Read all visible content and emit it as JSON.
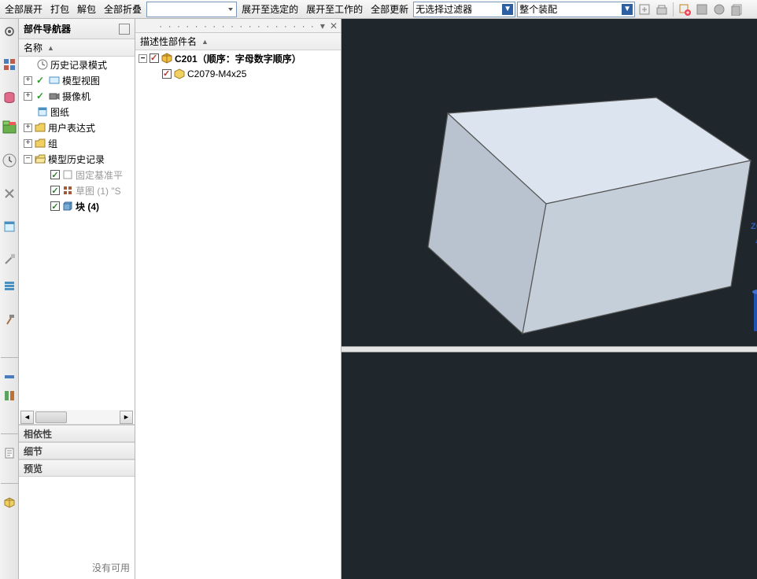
{
  "toolbar": {
    "expand_all": "全部展开",
    "pack": "打包",
    "unpack": "解包",
    "collapse_all": "全部折叠",
    "expand_to_selected": "展开至选定的",
    "expand_to_working": "展开至工作的",
    "update_all": "全部更新",
    "filter_select": "无选择过滤器",
    "scope_select": "整个装配"
  },
  "part_navigator": {
    "title": "部件导航器",
    "col_name": "名称",
    "items": {
      "history_mode": "历史记录模式",
      "model_views": "模型视图",
      "cameras": "摄像机",
      "drawings": "图纸",
      "user_expressions": "用户表达式",
      "groups": "组",
      "model_history": "模型历史记录",
      "datum_csys": "固定基准平",
      "sketch": "草图 (1) \"S",
      "block": "块 (4)"
    },
    "dep_section": "相依性",
    "detail_section": "细节",
    "preview_section": "预览",
    "preview_placeholder": "没有可用"
  },
  "descriptive_parts": {
    "col_name": "描述性部件名",
    "root": "C201（顺序：字母数字顺序）",
    "child": "C2079-M4x25"
  },
  "viewport": {
    "axis_z": "ZC",
    "axis_x": "XC"
  }
}
